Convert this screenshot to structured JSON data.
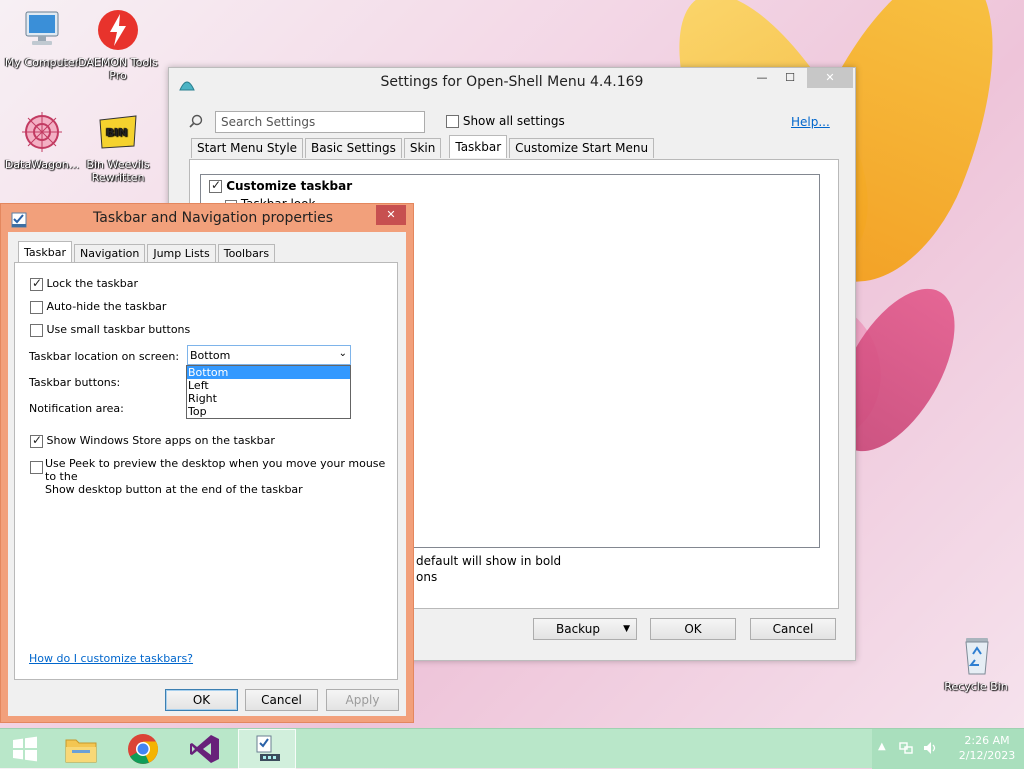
{
  "desktop": {
    "icons": [
      {
        "label": "My Computer"
      },
      {
        "label": "DAEMON Tools Pro"
      },
      {
        "label": "DataWagon..."
      },
      {
        "label": "Bin Weevils Rewritten"
      },
      {
        "label": "Recycle Bin"
      }
    ]
  },
  "openshell": {
    "title": "Settings for Open-Shell Menu 4.4.169",
    "search_placeholder": "Search Settings",
    "show_all_label": "Show all settings",
    "help_link": "Help...",
    "tabs": [
      "Start Menu Style",
      "Basic Settings",
      "Skin",
      "Taskbar",
      "Customize Start Menu"
    ],
    "active_tab": "Taskbar",
    "tree": {
      "customize_taskbar": "Customize taskbar",
      "taskbar_look": "Taskbar look"
    },
    "note_line1": "default will show in bold",
    "note_line2": "ons",
    "buttons": {
      "backup": "Backup",
      "ok": "OK",
      "cancel": "Cancel"
    }
  },
  "taskbar_props": {
    "title": "Taskbar and Navigation properties",
    "tabs": [
      "Taskbar",
      "Navigation",
      "Jump Lists",
      "Toolbars"
    ],
    "active_tab": "Taskbar",
    "options": {
      "lock": {
        "label": "Lock the taskbar",
        "checked": true
      },
      "autohide": {
        "label": "Auto-hide the taskbar",
        "checked": false
      },
      "small_buttons": {
        "label": "Use small taskbar buttons",
        "checked": false
      }
    },
    "location_label": "Taskbar location on screen:",
    "location_value": "Bottom",
    "location_options": [
      "Bottom",
      "Left",
      "Right",
      "Top"
    ],
    "buttons_label": "Taskbar buttons:",
    "notification_label": "Notification area:",
    "store_apps": {
      "label": "Show Windows Store apps on the taskbar",
      "checked": true
    },
    "peek": {
      "label_line1": "Use Peek to preview the desktop when you move your mouse to the",
      "label_line2": "Show desktop button at the end of the taskbar",
      "checked": false
    },
    "help_link": "How do I customize taskbars?",
    "buttons": {
      "ok": "OK",
      "cancel": "Cancel",
      "apply": "Apply"
    }
  },
  "taskbar": {
    "clock_time": "2:26 AM",
    "clock_date": "2/12/2023",
    "colors": {
      "bar": "#b9e7c9"
    }
  }
}
